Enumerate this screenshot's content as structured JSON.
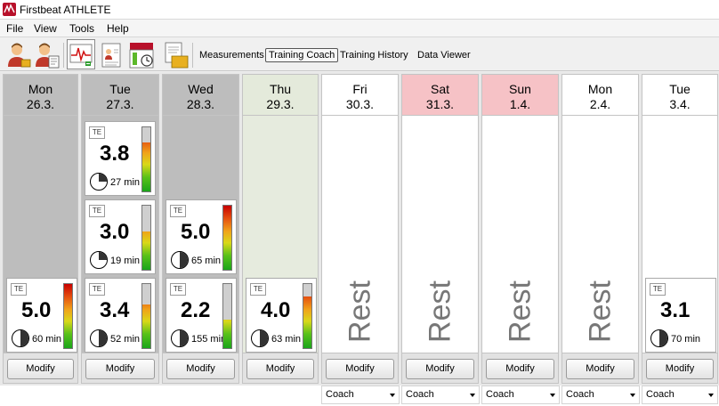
{
  "window": {
    "title": "Firstbeat ATHLETE"
  },
  "menu": [
    "File",
    "View",
    "Tools",
    "Help"
  ],
  "toolbar": {
    "icons": [
      "athlete-icon",
      "edit-athlete-icon",
      "heart-rate-chart-icon",
      "report-icon",
      "training-schedule-icon",
      "export-icon"
    ],
    "views": [
      "Measurements",
      "Training Coach",
      "Training History",
      "Data Viewer"
    ],
    "active_view": "Training Coach"
  },
  "days": [
    {
      "name": "Mon",
      "date": "26.3.",
      "state": "past",
      "sessions": [
        {
          "te_label": "TE",
          "te": "5.0",
          "duration": "60 min"
        }
      ],
      "rest": null,
      "modify_label": "Modify",
      "coach": null
    },
    {
      "name": "Tue",
      "date": "27.3.",
      "state": "past",
      "sessions": [
        {
          "te_label": "TE",
          "te": "3.8",
          "duration": "27 min"
        },
        {
          "te_label": "TE",
          "te": "3.0",
          "duration": "19 min"
        },
        {
          "te_label": "TE",
          "te": "3.4",
          "duration": "52 min"
        }
      ],
      "rest": null,
      "modify_label": "Modify",
      "coach": null
    },
    {
      "name": "Wed",
      "date": "28.3.",
      "state": "past",
      "sessions": [
        {
          "te_label": "TE",
          "te": "5.0",
          "duration": "65 min"
        },
        {
          "te_label": "TE",
          "te": "2.2",
          "duration": "155 min"
        }
      ],
      "rest": null,
      "modify_label": "Modify",
      "coach": null
    },
    {
      "name": "Thu",
      "date": "29.3.",
      "state": "today",
      "sessions": [
        {
          "te_label": "TE",
          "te": "4.0",
          "duration": "63 min"
        }
      ],
      "rest": null,
      "modify_label": "Modify",
      "coach": null
    },
    {
      "name": "Fri",
      "date": "30.3.",
      "state": "future",
      "sessions": [],
      "rest": "Rest",
      "modify_label": "Modify",
      "coach": "Coach"
    },
    {
      "name": "Sat",
      "date": "31.3.",
      "state": "future weekend",
      "sessions": [],
      "rest": "Rest",
      "modify_label": "Modify",
      "coach": "Coach"
    },
    {
      "name": "Sun",
      "date": "1.4.",
      "state": "future weekend",
      "sessions": [],
      "rest": "Rest",
      "modify_label": "Modify",
      "coach": "Coach"
    },
    {
      "name": "Mon",
      "date": "2.4.",
      "state": "future",
      "sessions": [],
      "rest": "Rest",
      "modify_label": "Modify",
      "coach": "Coach"
    },
    {
      "name": "Tue",
      "date": "3.4.",
      "state": "future",
      "sessions": [
        {
          "te_label": "TE",
          "te": "3.1",
          "duration": "70 min"
        }
      ],
      "rest": null,
      "modify_label": "Modify",
      "coach": "Coach"
    }
  ],
  "te_scale": [
    "5",
    "4",
    "3",
    "2",
    "1"
  ],
  "colors": {
    "past": "#bdbdbd",
    "today": "#e6ebde",
    "weekend_header": "#f6c2c6",
    "future": "#ffffff",
    "app_icon": "#b8102a"
  }
}
